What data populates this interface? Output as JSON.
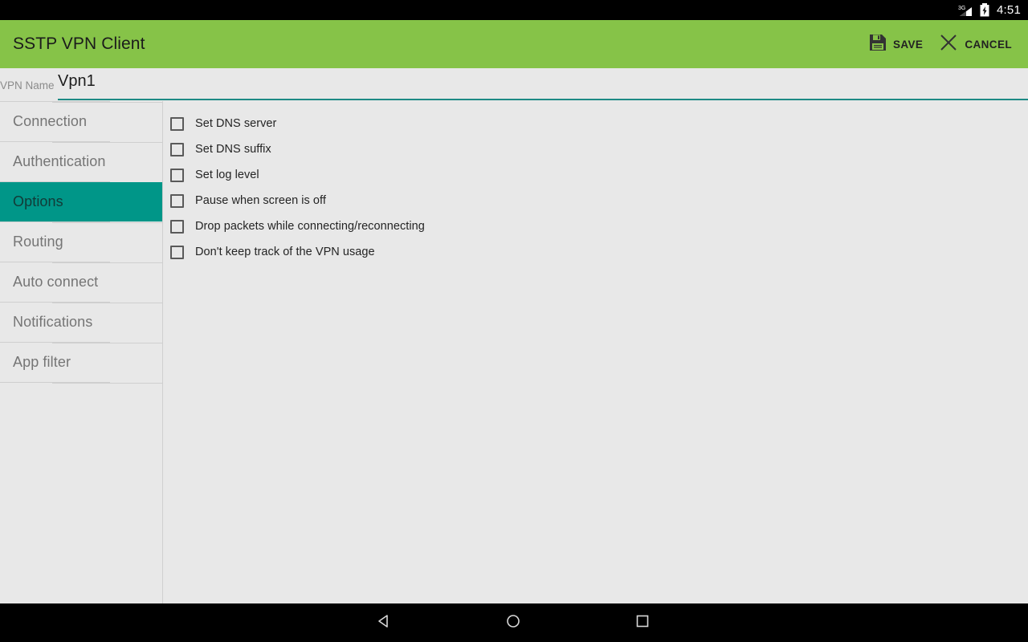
{
  "status_bar": {
    "network_label": "3G",
    "icons": [
      "signal-3g-icon",
      "battery-charging-icon"
    ],
    "clock": "4:51"
  },
  "action_bar": {
    "title": "SSTP VPN Client",
    "background_color": "#86c348",
    "buttons": [
      {
        "id": "save",
        "label": "SAVE",
        "icon": "save-floppy-icon"
      },
      {
        "id": "cancel",
        "label": "CANCEL",
        "icon": "close-x-icon"
      }
    ]
  },
  "vpn_name": {
    "label": "VPN Name",
    "value": "Vpn1",
    "placeholder": "VPN Name",
    "underline_color": "#1d8a84"
  },
  "sidebar": {
    "selected_color": "#009688",
    "items": [
      {
        "label": "Connection",
        "selected": false
      },
      {
        "label": "Authentication",
        "selected": false
      },
      {
        "label": "Options",
        "selected": true
      },
      {
        "label": "Routing",
        "selected": false
      },
      {
        "label": "Auto connect",
        "selected": false
      },
      {
        "label": "Notifications",
        "selected": false
      },
      {
        "label": "App filter",
        "selected": false
      }
    ]
  },
  "options_panel": {
    "checkboxes": [
      {
        "label": "Set DNS server",
        "checked": false
      },
      {
        "label": "Set DNS suffix",
        "checked": false
      },
      {
        "label": "Set log level",
        "checked": false
      },
      {
        "label": "Pause when screen is off",
        "checked": false
      },
      {
        "label": "Drop packets while connecting/reconnecting",
        "checked": false
      },
      {
        "label": "Don't keep track of the VPN usage",
        "checked": false
      }
    ]
  },
  "nav_bar": {
    "buttons": [
      {
        "id": "back",
        "icon": "back-triangle-icon"
      },
      {
        "id": "home",
        "icon": "home-circle-icon"
      },
      {
        "id": "recent",
        "icon": "recents-square-icon"
      }
    ]
  }
}
